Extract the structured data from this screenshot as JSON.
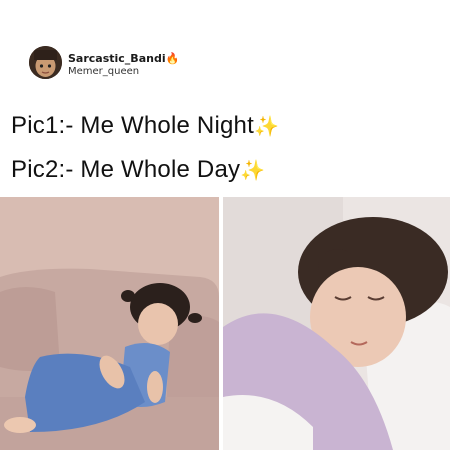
{
  "post": {
    "author_name": "Sarcastic_Bandi",
    "author_emoji": "🔥",
    "author_subname": "Memer_queen"
  },
  "captions": [
    {
      "text": "Pic1:- Me Whole Night",
      "emoji": "✨"
    },
    {
      "text": "Pic2:- Me Whole Day",
      "emoji": "✨"
    }
  ],
  "images": [
    {
      "icon": "sleeping-child-on-couch-photo"
    },
    {
      "icon": "sleeping-child-in-bed-photo"
    }
  ]
}
